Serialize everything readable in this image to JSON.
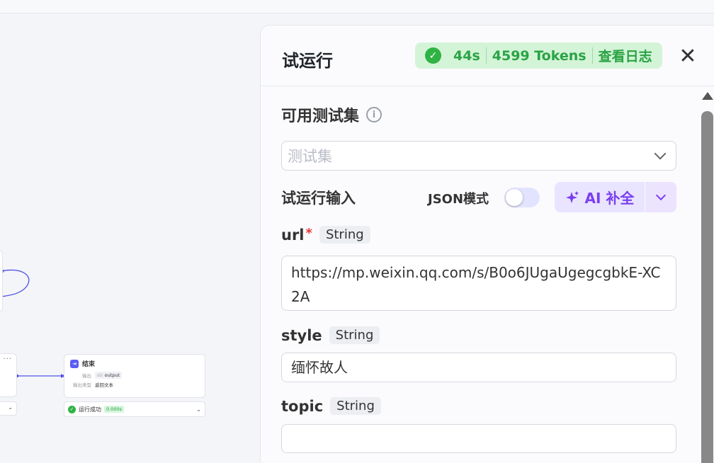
{
  "workflow": {
    "left_node_more": "···",
    "end_node": {
      "icon": "end-icon",
      "title": "结束",
      "output_label": "输出",
      "output_type": "str",
      "output_name": "output",
      "output_type_label": "输出类型",
      "output_type_value": "返回文本",
      "status_text": "运行成功",
      "status_time": "0.000s"
    }
  },
  "panel": {
    "title": "试运行",
    "run_time": "44s",
    "tokens": "4599 Tokens",
    "view_logs": "查看日志",
    "close_icon": "close-icon",
    "test_set_title": "可用测试集",
    "test_set_placeholder": "测试集",
    "run_input_title": "试运行输入",
    "json_mode_label": "JSON模式",
    "json_mode_enabled": false,
    "ai_complete_label": "AI 补全",
    "fields": [
      {
        "name": "url",
        "required": "*",
        "type": "String",
        "value": "https://mp.weixin.qq.com/s/B0o6JUgaUgegcgbkE-XC2A"
      },
      {
        "name": "style",
        "type": "String",
        "value": "缅怀故人"
      },
      {
        "name": "topic",
        "type": "String",
        "value": ""
      }
    ]
  },
  "colors": {
    "success": "#2fb344",
    "accent": "#5a5cf2",
    "ai": "#7a3ff0"
  }
}
